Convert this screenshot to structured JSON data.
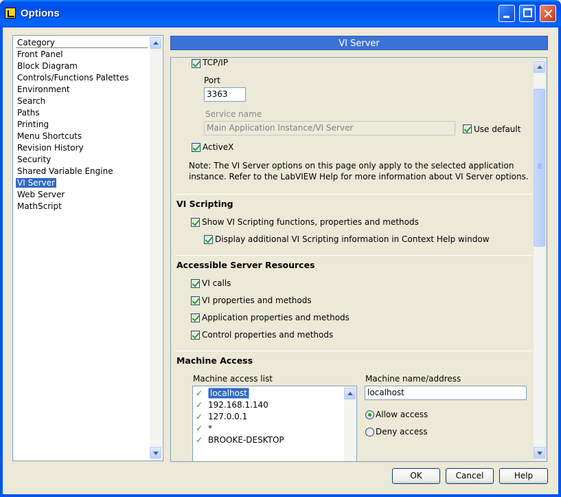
{
  "window": {
    "title": "Options"
  },
  "category": {
    "header": "Category",
    "items": [
      {
        "label": "Front Panel"
      },
      {
        "label": "Block Diagram"
      },
      {
        "label": "Controls/Functions Palettes"
      },
      {
        "label": "Environment"
      },
      {
        "label": "Search"
      },
      {
        "label": "Paths"
      },
      {
        "label": "Printing"
      },
      {
        "label": "Menu Shortcuts"
      },
      {
        "label": "Revision History"
      },
      {
        "label": "Security"
      },
      {
        "label": "Shared Variable Engine"
      },
      {
        "label": "VI Server",
        "selected": true
      },
      {
        "label": "Web Server"
      },
      {
        "label": "MathScript"
      }
    ]
  },
  "panel": {
    "title": "VI Server",
    "protocols": {
      "tcp_ip": {
        "label": "TCP/IP",
        "checked": true
      },
      "port_label": "Port",
      "port_value": "3363",
      "service_name_label": "Service name",
      "service_name_value": "Main Application Instance/VI Server",
      "use_default": {
        "label": "Use default",
        "checked": true
      },
      "activex": {
        "label": "ActiveX",
        "checked": true
      },
      "note": "Note: The VI Server options on this page only apply to the selected application",
      "note2": "instance. Refer to the LabVIEW Help for more information about VI Server options."
    },
    "scripting": {
      "heading": "VI Scripting",
      "show_scripting": {
        "label": "Show VI Scripting functions, properties and methods",
        "checked": true
      },
      "context_help": {
        "label": "Display additional VI Scripting information in Context Help window",
        "checked": true
      }
    },
    "resources": {
      "heading": "Accessible Server Resources",
      "vi_calls": {
        "label": "VI calls",
        "checked": true
      },
      "vi_props": {
        "label": "VI properties and methods",
        "checked": true
      },
      "app_props": {
        "label": "Application properties and methods",
        "checked": true
      },
      "ctrl_props": {
        "label": "Control properties and methods",
        "checked": true
      }
    },
    "machine": {
      "heading": "Machine Access",
      "list_label": "Machine access list",
      "entries": [
        {
          "name": "localhost",
          "allowed": true,
          "selected": true
        },
        {
          "name": "192.168.1.140",
          "allowed": true
        },
        {
          "name": "127.0.0.1",
          "allowed": true
        },
        {
          "name": "*",
          "allowed": true
        },
        {
          "name": "BROOKE-DESKTOP",
          "allowed": true
        }
      ],
      "check_glyph": "✓",
      "name_label": "Machine name/address",
      "name_value": "localhost",
      "allow_label": "Allow access",
      "deny_label": "Deny access",
      "access": "allow"
    }
  },
  "buttons": {
    "ok": "OK",
    "cancel": "Cancel",
    "help": "Help"
  },
  "colors": {
    "title_bar": "#0055ea",
    "selection": "#316ac5",
    "panel_header": "#3b73d5",
    "check_green": "#21a121"
  }
}
